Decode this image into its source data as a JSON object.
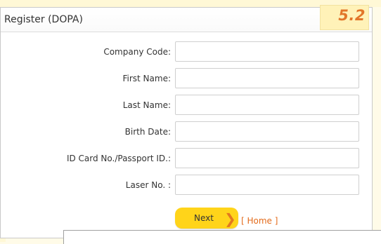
{
  "header": {
    "title": "Register (DOPA)",
    "step_badge": "5.2"
  },
  "form": {
    "fields": [
      {
        "label": "Company Code:",
        "value": "",
        "placeholder": ""
      },
      {
        "label": "First Name:",
        "value": "",
        "placeholder": ""
      },
      {
        "label": "Last Name:",
        "value": "",
        "placeholder": ""
      },
      {
        "label": "Birth Date:",
        "value": "",
        "placeholder": ""
      },
      {
        "label": "ID Card No./Passport ID.:",
        "value": "",
        "placeholder": ""
      },
      {
        "label": "Laser No. :",
        "value": "",
        "placeholder": ""
      }
    ]
  },
  "actions": {
    "next_label": "Next",
    "next_arrow_icon": "chevron-right-icon",
    "home_link": "[ Home ]"
  },
  "colors": {
    "accent_orange": "#e2762a",
    "button_yellow": "#ffd41a",
    "badge_bg": "#fff2b8"
  }
}
